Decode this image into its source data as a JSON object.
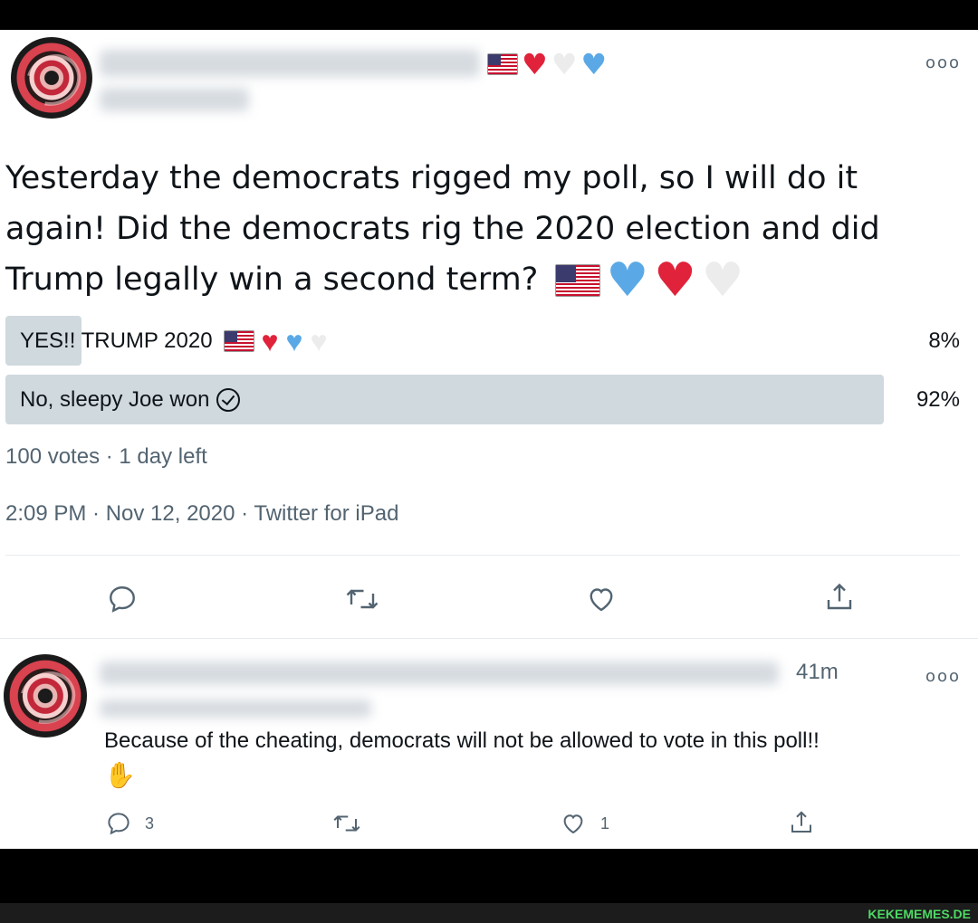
{
  "tweet": {
    "more_icon": "more-horizontal-icon",
    "name_emojis": [
      "flag-us",
      "red-heart",
      "white-heart",
      "blue-heart"
    ],
    "text": "Yesterday the democrats rigged my poll, so I will do it again! Did the democrats rig the 2020 election and did Trump legally win a second term?",
    "text_emojis": [
      "flag-us",
      "blue-heart",
      "red-heart",
      "white-heart"
    ],
    "poll": {
      "options": [
        {
          "label": "YES!! TRUMP 2020",
          "percent": "8%",
          "fraction": 0.08,
          "emojis": [
            "flag-us",
            "red-heart",
            "blue-heart",
            "white-heart"
          ],
          "selected": false
        },
        {
          "label": "No, sleepy Joe won",
          "percent": "92%",
          "fraction": 0.92,
          "selected": true
        }
      ],
      "summary": "100 votes · 1 day left"
    },
    "timestamp": "2:09 PM · Nov 12, 2020 · Twitter for iPad",
    "actions": {
      "reply_icon": "reply-icon",
      "retweet_icon": "retweet-icon",
      "like_icon": "heart-icon",
      "share_icon": "share-icon"
    }
  },
  "reply": {
    "time_ago": "41m",
    "text": "Because of the cheating, democrats will not be allowed to vote in this poll!!",
    "emoji": "person-tipping-hand",
    "actions": {
      "reply_count": "3",
      "retweet_count": "",
      "like_count": "1"
    }
  },
  "watermark": "KEKEMEMES.DE",
  "colors": {
    "poll_fill": "#cfd9de",
    "meta_text": "#536471",
    "heart_red": "#e0223b",
    "heart_blue": "#5aa9e6",
    "watermark": "#4cd964"
  }
}
